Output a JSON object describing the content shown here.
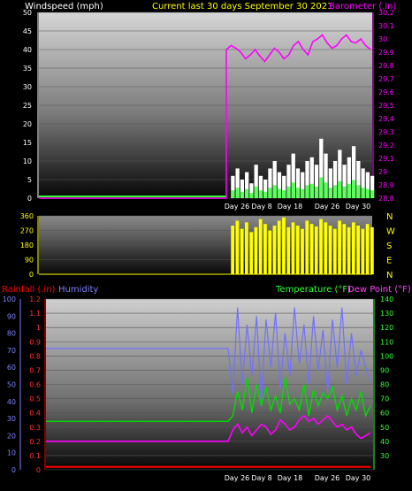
{
  "header": {
    "left_label": "Windspeed (mph)",
    "center_label": "Current last 30 days September 30 2021",
    "right_label": "Barometer (.in)"
  },
  "colors": {
    "windspeed": "#ffffff",
    "gust": "#33ff33",
    "barometer": "#ff00ff",
    "direction": "#ffff00",
    "humidity": "#7070ff",
    "temperature": "#00dd00",
    "dewpoint": "#ff00ff",
    "rainfall": "#ff0000"
  },
  "chart_data": [
    {
      "id": "wind-barometer",
      "type": "line",
      "title": "Current last 30 days September 30 2021",
      "x_ticks": [
        "Day 26",
        "Day 8",
        "Day 18",
        "Day 26",
        "Day 30"
      ],
      "y_left": {
        "label": "Windspeed (mph)",
        "range": [
          0,
          50
        ],
        "ticks": [
          0,
          5,
          10,
          15,
          20,
          25,
          30,
          35,
          40,
          45,
          50
        ]
      },
      "y_right": {
        "label": "Barometer (.in)",
        "range": [
          28.8,
          30.2
        ],
        "ticks": [
          28.8,
          28.9,
          29.0,
          29.1,
          29.2,
          29.3,
          29.4,
          29.5,
          29.6,
          29.7,
          29.8,
          29.9,
          30.0,
          30.1,
          30.2
        ]
      },
      "series": [
        {
          "axis": "right",
          "values": [
            28.8,
            29.92,
            29.95,
            29.93,
            29.9,
            29.85,
            29.88,
            29.92,
            29.87,
            29.83,
            29.88,
            29.93,
            29.9,
            29.85,
            29.88,
            29.95,
            29.98,
            29.92,
            29.88,
            29.98,
            30.0,
            30.03,
            29.97,
            29.93,
            29.95,
            30.0,
            30.03,
            29.98,
            29.97,
            30.0,
            29.95,
            29.92
          ]
        },
        {
          "axis": "left",
          "values": [
            0,
            6,
            8,
            5,
            7,
            4,
            9,
            6,
            5,
            8,
            10,
            7,
            6,
            9,
            12,
            8,
            7,
            10,
            11,
            9,
            16,
            12,
            8,
            10,
            13,
            9,
            11,
            14,
            10,
            8,
            7,
            6
          ]
        }
      ]
    },
    {
      "id": "wind-direction",
      "type": "area",
      "y_left": {
        "range": [
          0,
          360
        ],
        "ticks": [
          0,
          90,
          180,
          270,
          360
        ]
      },
      "y_right_labels": [
        "N",
        "W",
        "S",
        "E",
        "N"
      ],
      "series": [
        {
          "values": [
            0,
            300,
            330,
            280,
            320,
            260,
            290,
            340,
            310,
            270,
            300,
            330,
            350,
            290,
            320,
            300,
            280,
            330,
            310,
            295,
            340,
            320,
            300,
            280,
            330,
            310,
            290,
            320,
            300,
            280,
            310,
            290
          ]
        }
      ]
    },
    {
      "id": "rain-humidity-temp",
      "type": "line",
      "legend": {
        "rainfall": "Rainfall (.in)",
        "humidity": "Humidity",
        "temperature": "Temperature (°F)",
        "dewpoint": "Dew Point (°F)"
      },
      "x_ticks": [
        "Day 26",
        "Day 8",
        "Day 18",
        "Day 26",
        "Day 30"
      ],
      "y_humidity": {
        "range": [
          0,
          100
        ],
        "ticks": [
          0,
          10,
          20,
          30,
          40,
          50,
          60,
          70,
          80,
          90,
          100
        ]
      },
      "y_rain": {
        "range": [
          0,
          1.2
        ],
        "ticks": [
          0,
          0.1,
          0.2,
          0.3,
          0.4,
          0.5,
          0.6,
          0.7,
          0.8,
          0.9,
          1,
          1.1,
          1.2
        ]
      },
      "y_temp": {
        "range": [
          20,
          140
        ],
        "ticks": [
          30,
          40,
          50,
          60,
          70,
          80,
          90,
          100,
          110,
          120,
          130,
          140
        ]
      },
      "series": [
        {
          "name": "Humidity",
          "axis": "humidity",
          "values": [
            71,
            71,
            45,
            95,
            50,
            85,
            55,
            90,
            40,
            88,
            60,
            92,
            48,
            80,
            55,
            95,
            62,
            85,
            50,
            90,
            58,
            82,
            45,
            88,
            60,
            95,
            50,
            80,
            55,
            70,
            60,
            52
          ]
        },
        {
          "name": "Temperature (°F)",
          "axis": "temp",
          "values": [
            54,
            54,
            58,
            75,
            62,
            85,
            60,
            80,
            65,
            78,
            62,
            72,
            60,
            85,
            66,
            70,
            62,
            80,
            58,
            76,
            65,
            74,
            70,
            78,
            62,
            72,
            58,
            70,
            62,
            75,
            58,
            65
          ]
        },
        {
          "name": "Dew Point (°F)",
          "axis": "temp",
          "values": [
            40,
            40,
            48,
            52,
            46,
            50,
            44,
            48,
            52,
            50,
            45,
            48,
            55,
            52,
            48,
            50,
            55,
            58,
            54,
            56,
            52,
            55,
            58,
            54,
            50,
            52,
            48,
            50,
            45,
            42,
            44,
            46
          ]
        },
        {
          "name": "Rainfall (.in)",
          "axis": "rain",
          "values": [
            0.02,
            0.02,
            0.02,
            0.02,
            0.02,
            0.02,
            0.02,
            0.02,
            0.02,
            0.02,
            0.02,
            0.02,
            0.02,
            0.02,
            0.02,
            0.02,
            0.02,
            0.02,
            0.02,
            0.02,
            0.02,
            0.02,
            0.02,
            0.02,
            0.02,
            0.02,
            0.02,
            0.02,
            0.02,
            0.02,
            0.02,
            0.02
          ]
        }
      ]
    }
  ]
}
